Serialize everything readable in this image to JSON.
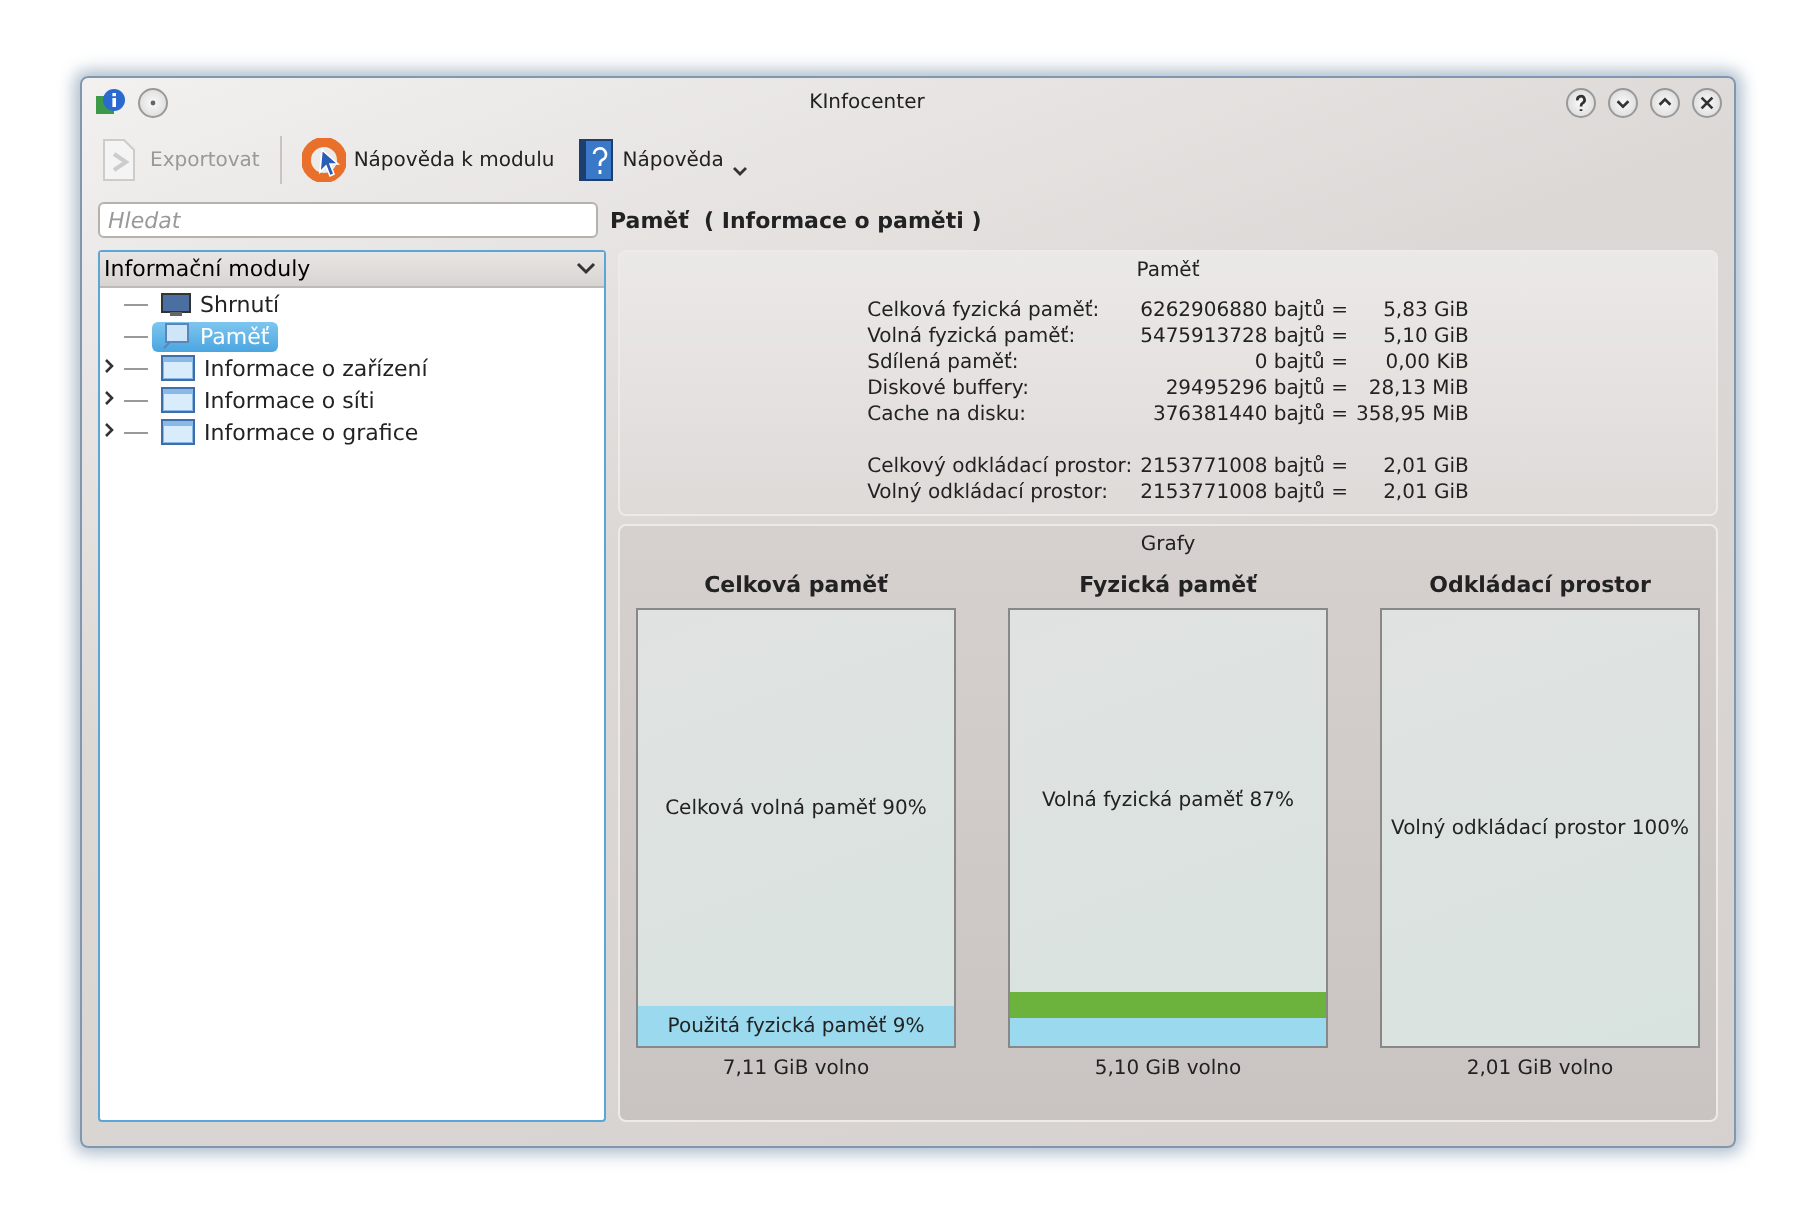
{
  "window": {
    "title": "KInfocenter"
  },
  "title_buttons": [
    {
      "kind": "help"
    },
    {
      "kind": "minimize"
    },
    {
      "kind": "maximize"
    },
    {
      "kind": "close"
    }
  ],
  "toolbar": [
    {
      "kind": "export",
      "label": "Exportovat",
      "disabled": true
    },
    {
      "kind": "module-help",
      "label": "Nápověda k modulu",
      "disabled": false
    },
    {
      "kind": "help",
      "label": "Nápověda",
      "disabled": false,
      "menu": true
    }
  ],
  "search": {
    "placeholder": "Hledat"
  },
  "heading": "Paměť  ( Informace o paměti )",
  "sidebar": {
    "title": "Informační moduly",
    "items": [
      {
        "label": "Shrnutí",
        "kind": "monitor",
        "selected": false,
        "expandable": false
      },
      {
        "label": "Paměť",
        "kind": "computer",
        "selected": true,
        "expandable": false
      },
      {
        "label": "Informace o zařízení",
        "kind": "folder",
        "selected": false,
        "expandable": true
      },
      {
        "label": "Informace o síti",
        "kind": "folder",
        "selected": false,
        "expandable": true
      },
      {
        "label": "Informace o grafice",
        "kind": "folder",
        "selected": false,
        "expandable": true
      }
    ]
  },
  "memory": {
    "title": "Paměť",
    "groups": [
      [
        {
          "label": "Celková fyzická paměť:",
          "bytes": "6262906880 bajtů =",
          "size": "5,83 GiB"
        },
        {
          "label": "Volná fyzická paměť:",
          "bytes": "5475913728 bajtů =",
          "size": "5,10 GiB"
        },
        {
          "label": "Sdílená paměť:",
          "bytes": "0 bajtů =",
          "size": "0,00 KiB"
        },
        {
          "label": "Diskové buffery:",
          "bytes": "29495296 bajtů =",
          "size": "28,13 MiB"
        },
        {
          "label": "Cache na disku:",
          "bytes": "376381440 bajtů =",
          "size": "358,95 MiB"
        }
      ],
      [
        {
          "label": "Celkový odkládací prostor:",
          "bytes": "2153771008 bajtů =",
          "size": "2,01 GiB"
        },
        {
          "label": "Volný odkládací prostor:",
          "bytes": "2153771008 bajtů =",
          "size": "2,01 GiB"
        }
      ]
    ]
  },
  "graphs": {
    "title": "Grafy",
    "items": [
      {
        "title": "Celková paměť",
        "free_label": "Celková volná paměť 90%",
        "footer": "7,11 GiB volno",
        "segments": [
          {
            "label": "Použitá fyzická paměť 9%",
            "level": 0.09,
            "color": "#9ad9ee"
          }
        ]
      },
      {
        "title": "Fyzická paměť",
        "free_label": "Volná fyzická paměť 87%",
        "footer": "5,10 GiB volno",
        "segments": [
          {
            "level": 0.065,
            "color": "#9ad9ee"
          },
          {
            "level": 0.06,
            "color": "#6cb33e"
          }
        ]
      },
      {
        "title": "Odkládací prostor",
        "free_label": "Volný odkládací prostor 100%",
        "footer": "2,01 GiB volno"
      }
    ]
  }
}
